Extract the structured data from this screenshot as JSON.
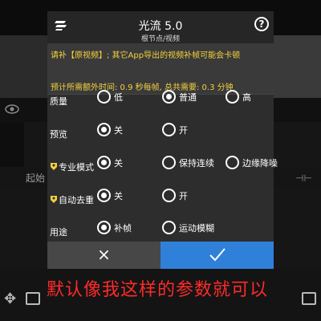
{
  "dialog": {
    "title": "光流 5.0",
    "subtitle": "根节点/视频",
    "notice_line1": "请补【原视频】; 其它App导出的视频补帧可能会卡顿",
    "notice_line2": "预计所需额外时间: 0.9 秒每帧, 总共需要: 0.3 分钟",
    "rows": [
      {
        "label": "质量",
        "options": [
          {
            "label": "低",
            "checked": false
          },
          {
            "label": "普通",
            "checked": true
          },
          {
            "label": "高",
            "checked": false
          }
        ]
      },
      {
        "label": "预览",
        "options": [
          {
            "label": "关",
            "checked": true
          },
          {
            "label": "开",
            "checked": false
          }
        ]
      },
      {
        "label": "专业模式",
        "options": [
          {
            "label": "关",
            "checked": true
          },
          {
            "label": "保持连续",
            "checked": false
          },
          {
            "label": "边缘降噪",
            "checked": false
          }
        ]
      },
      {
        "label": "自动去重",
        "options": [
          {
            "label": "关",
            "checked": true
          },
          {
            "label": "开",
            "checked": false
          }
        ]
      },
      {
        "label": "用途",
        "options": [
          {
            "label": "补帧",
            "checked": true
          },
          {
            "label": "运动模糊",
            "checked": false
          }
        ]
      }
    ],
    "cancel_label": "×"
  },
  "background": {
    "track_label": "起始"
  },
  "caption": "默认像我这样的参数就可以",
  "colors": {
    "notice_text": "#f4d23c",
    "confirm": "#2f80d9",
    "caption": "#ff2a2a"
  },
  "icons": {
    "logo": "app-logo-icon",
    "help": "help-icon",
    "tag": "gem-tag-icon",
    "confirm": "checkmark-icon"
  }
}
